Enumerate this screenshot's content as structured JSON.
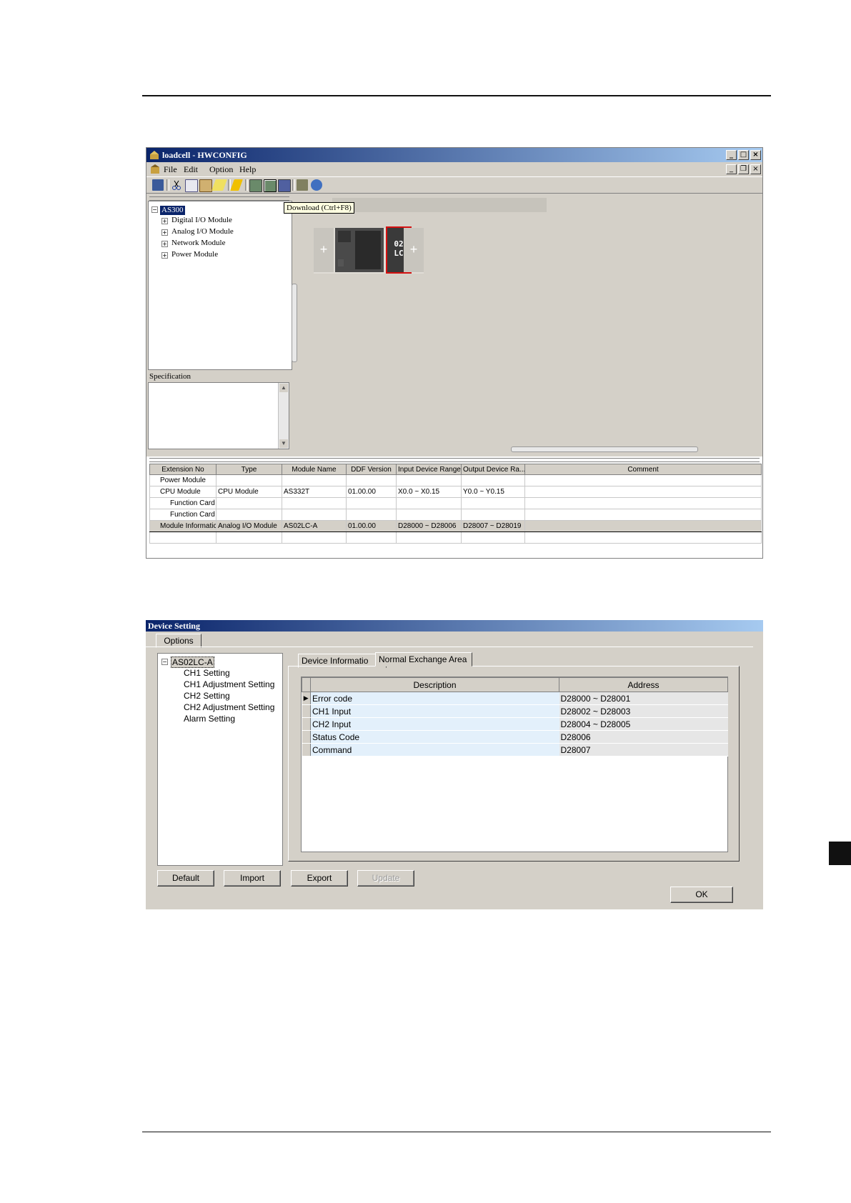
{
  "hwconfig": {
    "title": "loadcell - HWCONFIG",
    "window_buttons": [
      "_",
      "□",
      "×"
    ],
    "menu": [
      "File",
      "Edit",
      "Option",
      "Help"
    ],
    "tooltip": "Download (Ctrl+F8)",
    "tree": {
      "root": "AS300",
      "children": [
        "Digital I/O Module",
        "Analog I/O Module",
        "Network Module",
        "Power Module"
      ]
    },
    "spec_label": "Specification",
    "rack": {
      "plus": "+",
      "module_label_1": "02",
      "module_label_2": "LC"
    },
    "grid": {
      "headers": [
        "Extension No",
        "Type",
        "Module Name",
        "DDF Version",
        "Input Device Range",
        "Output Device Ra...",
        "Comment"
      ],
      "rows": [
        [
          "Power Module",
          "",
          "",
          "",
          "",
          "",
          ""
        ],
        [
          "CPU Module",
          "CPU Module",
          "AS332T",
          "01.00.00",
          "X0.0 ~ X0.15",
          "Y0.0 ~ Y0.15",
          ""
        ],
        [
          "Function Card",
          "",
          "",
          "",
          "",
          "",
          ""
        ],
        [
          "Function Card",
          "",
          "",
          "",
          "",
          "",
          ""
        ],
        [
          "Module Informatic",
          "Analog I/O Module",
          "AS02LC-A",
          "01.00.00",
          "D28000 ~ D28006",
          "D28007 ~ D28019",
          ""
        ],
        [
          "",
          "",
          "",
          "",
          "",
          "",
          ""
        ]
      ]
    }
  },
  "device_setting": {
    "title": "Device Setting",
    "options_tab": "Options",
    "tree": {
      "root": "AS02LC-A",
      "children": [
        "CH1 Setting",
        "CH1 Adjustment Setting",
        "CH2 Setting",
        "CH2 Adjustment Setting",
        "Alarm Setting"
      ]
    },
    "tabs": [
      "Device Informatio",
      "Normal Exchange Area"
    ],
    "grid": {
      "headers": [
        "Description",
        "Address"
      ],
      "rows": [
        {
          "desc": "Error code",
          "addr": "D28000 ~ D28001"
        },
        {
          "desc": "CH1 Input",
          "addr": "D28002 ~ D28003"
        },
        {
          "desc": "CH2 Input",
          "addr": "D28004 ~ D28005"
        },
        {
          "desc": "Status Code",
          "addr": "D28006"
        },
        {
          "desc": "Command",
          "addr": "D28007"
        }
      ]
    },
    "buttons": {
      "default": "Default",
      "import": "Import",
      "export": "Export",
      "update": "Update",
      "ok": "OK"
    }
  }
}
